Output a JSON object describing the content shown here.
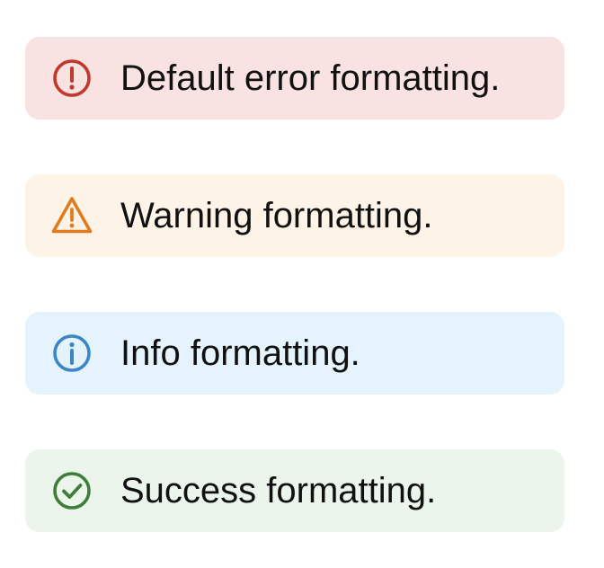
{
  "alerts": [
    {
      "type": "error",
      "icon": "alert-circle-icon",
      "message": "Default error formatting.",
      "background": "#f8e2e2",
      "accent": "#c0392b"
    },
    {
      "type": "warning",
      "icon": "warning-triangle-icon",
      "message": "Warning formatting.",
      "background": "#fdf4e7",
      "accent": "#e07b22"
    },
    {
      "type": "info",
      "icon": "info-circle-icon",
      "message": "Info formatting.",
      "background": "#e5f3fc",
      "accent": "#3a86c8"
    },
    {
      "type": "success",
      "icon": "check-circle-icon",
      "message": "Success formatting.",
      "background": "#ecf5ec",
      "accent": "#3f7d3a"
    }
  ]
}
